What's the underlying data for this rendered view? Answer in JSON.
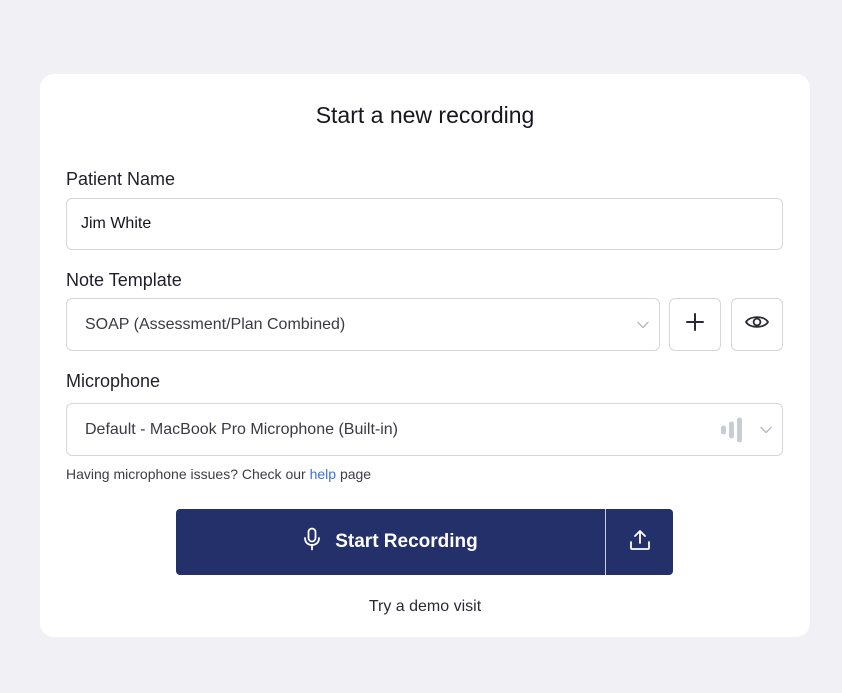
{
  "card": {
    "title": "Start a new recording"
  },
  "patient": {
    "label": "Patient Name",
    "value": "Jim White"
  },
  "template": {
    "label": "Note Template",
    "selected": "SOAP (Assessment/Plan Combined)",
    "add_icon": "plus-icon",
    "preview_icon": "eye-icon"
  },
  "microphone": {
    "label": "Microphone",
    "selected": "Default - MacBook Pro Microphone (Built-in)",
    "level_icon": "audio-level-icon"
  },
  "help": {
    "prefix": "Having microphone issues? Check our",
    "link": "help",
    "suffix": "page"
  },
  "actions": {
    "start_label": "Start Recording",
    "start_icon": "microphone-icon",
    "upload_icon": "upload-icon",
    "demo_link": "Try a demo visit"
  },
  "colors": {
    "primary": "#24306a",
    "link": "#3f6fe0",
    "background": "#f1f1f5"
  }
}
